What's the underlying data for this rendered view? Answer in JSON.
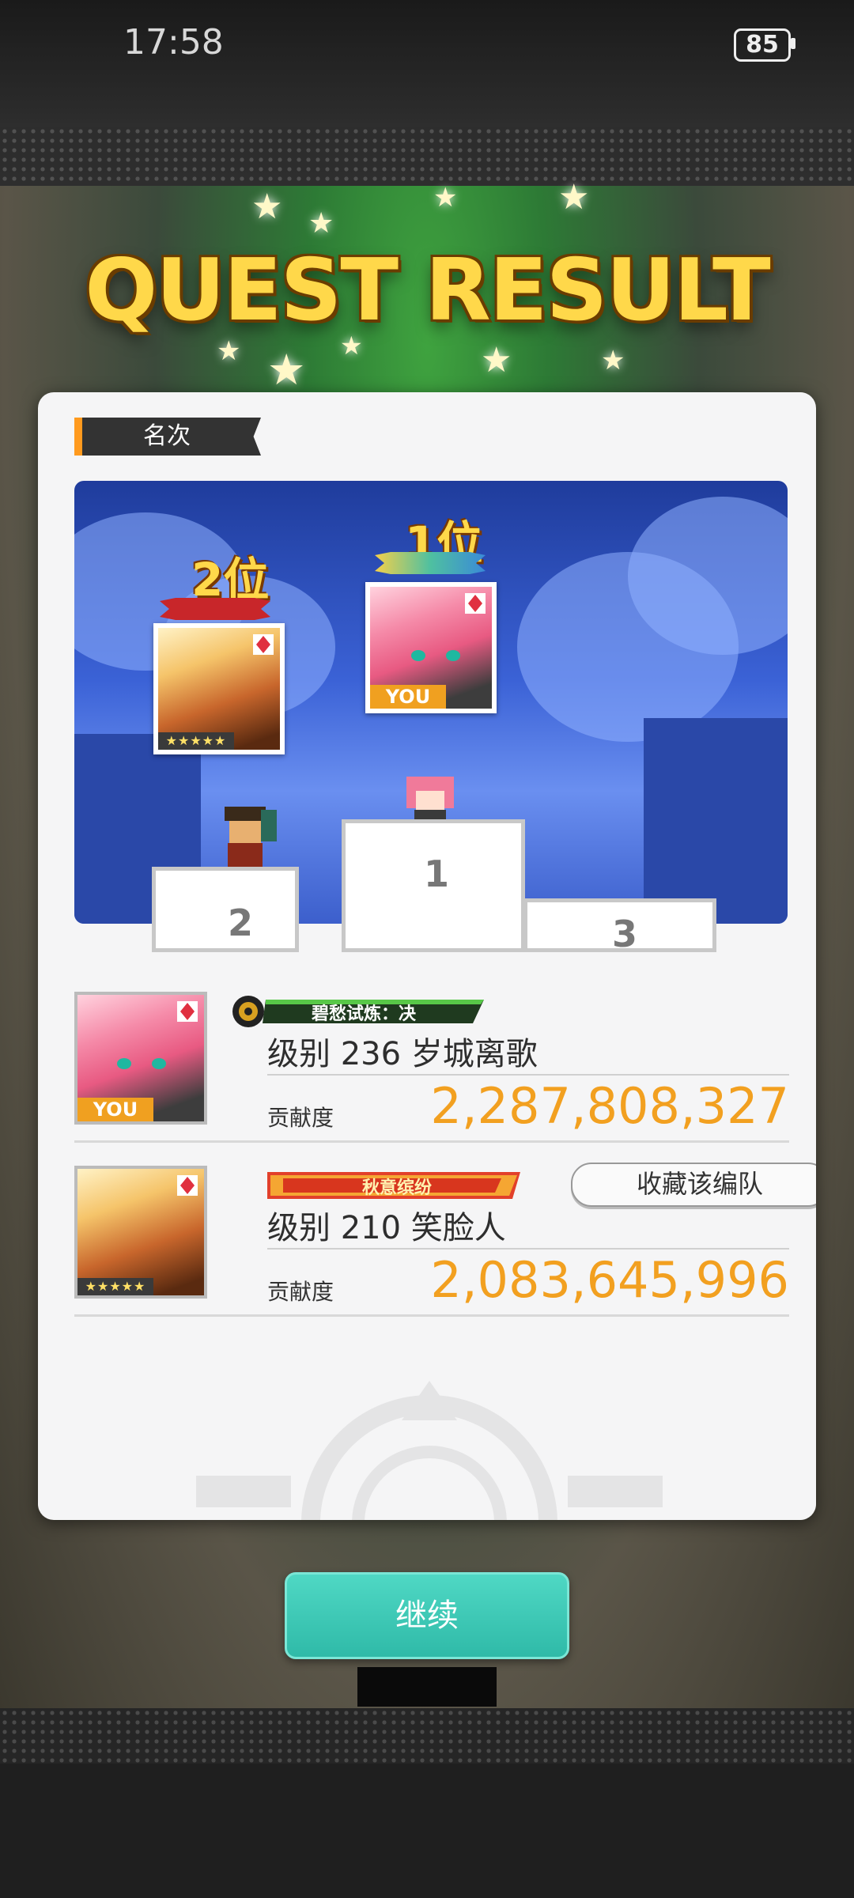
{
  "status_bar": {
    "time": "17:58",
    "battery": "85"
  },
  "header": {
    "title": "QUEST RESULT"
  },
  "panel": {
    "section_label": "名次",
    "podium": {
      "first_rank": "1位",
      "second_rank": "2位",
      "you_tag": "YOU",
      "numbers": [
        "1",
        "2",
        "3"
      ],
      "rarity_stars": "★★★★★"
    },
    "results": [
      {
        "title_badge": "碧愁试炼：决",
        "name": "级别 236 岁城离歌",
        "contribution_label": "贡献度",
        "contribution_value": "2,287,808,327",
        "tag": "YOU"
      },
      {
        "title_badge": "秋意缤纷",
        "name": "级别 210 笑脸人",
        "contribution_label": "贡献度",
        "contribution_value": "2,083,645,996",
        "tag": "★★★★★",
        "button": "收藏该编队"
      }
    ]
  },
  "footer": {
    "continue_label": "继续"
  },
  "colors": {
    "accent_orange": "#f2a020",
    "teal_button": "#2fbaa8",
    "title_gold": "#ffd84a"
  }
}
